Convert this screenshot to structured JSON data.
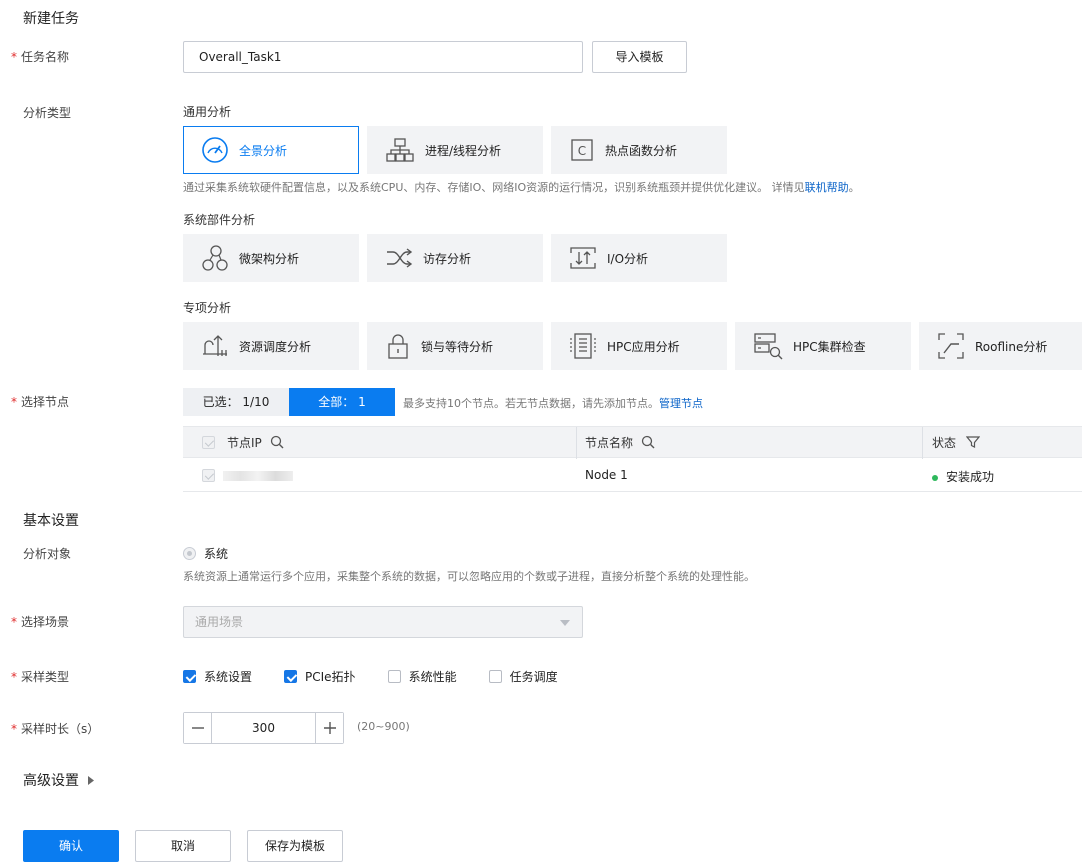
{
  "page_title": "新建任务",
  "task_name": {
    "label": "任务名称",
    "value": "Overall_Task1",
    "import_button": "导入模板"
  },
  "analysis_type": {
    "label": "分析类型",
    "general": {
      "title": "通用分析",
      "cards": [
        {
          "label": "全景分析",
          "icon": "gauge-icon",
          "selected": true
        },
        {
          "label": "进程/线程分析",
          "icon": "hierarchy-icon"
        },
        {
          "label": "热点函数分析",
          "icon": "c-function-icon"
        }
      ],
      "desc_text": "通过采集系统软硬件配置信息，以及系统CPU、内存、存储IO、网络IO资源的运行情况，识别系统瓶颈并提供优化建议。 详情见",
      "desc_link": "联机帮助",
      "desc_end": "。"
    },
    "component": {
      "title": "系统部件分析",
      "cards": [
        {
          "label": "微架构分析",
          "icon": "micro-arch-icon"
        },
        {
          "label": "访存分析",
          "icon": "shuffle-icon"
        },
        {
          "label": "I/O分析",
          "icon": "io-icon"
        }
      ]
    },
    "special": {
      "title": "专项分析",
      "cards": [
        {
          "label": "资源调度分析",
          "icon": "schedule-icon"
        },
        {
          "label": "锁与等待分析",
          "icon": "lock-icon"
        },
        {
          "label": "HPC应用分析",
          "icon": "hpc-app-icon"
        },
        {
          "label": "HPC集群检查",
          "icon": "hpc-cluster-icon"
        },
        {
          "label": "Roofline分析",
          "icon": "roofline-icon"
        }
      ]
    }
  },
  "select_node": {
    "label": "选择节点",
    "selected_tab": "已选： 1/10",
    "all_tab": "全部： 1",
    "hint": "最多支持10个节点。若无节点数据，请先添加节点。",
    "manage_link": "管理节点",
    "table": {
      "columns": [
        "节点IP",
        "节点名称",
        "状态"
      ],
      "rows": [
        {
          "name": "Node 1",
          "status": "安装成功"
        }
      ]
    }
  },
  "basic_settings": {
    "title": "基本设置",
    "target": {
      "label": "分析对象",
      "option": "系统",
      "desc": "系统资源上通常运行多个应用，采集整个系统的数据，可以忽略应用的个数或子进程，直接分析整个系统的处理性能。"
    },
    "scenario": {
      "label": "选择场景",
      "value": "通用场景"
    },
    "sample_type": {
      "label": "采样类型",
      "options": [
        {
          "label": "系统设置",
          "checked": true
        },
        {
          "label": "PCIe拓扑",
          "checked": true
        },
        {
          "label": "系统性能",
          "checked": false
        },
        {
          "label": "任务调度",
          "checked": false
        }
      ]
    },
    "duration": {
      "label": "采样时长（s）",
      "value": "300",
      "range": "(20~900)"
    }
  },
  "advanced": {
    "title": "高级设置"
  },
  "footer": {
    "confirm": "确认",
    "cancel": "取消",
    "save_template": "保存为模板"
  }
}
